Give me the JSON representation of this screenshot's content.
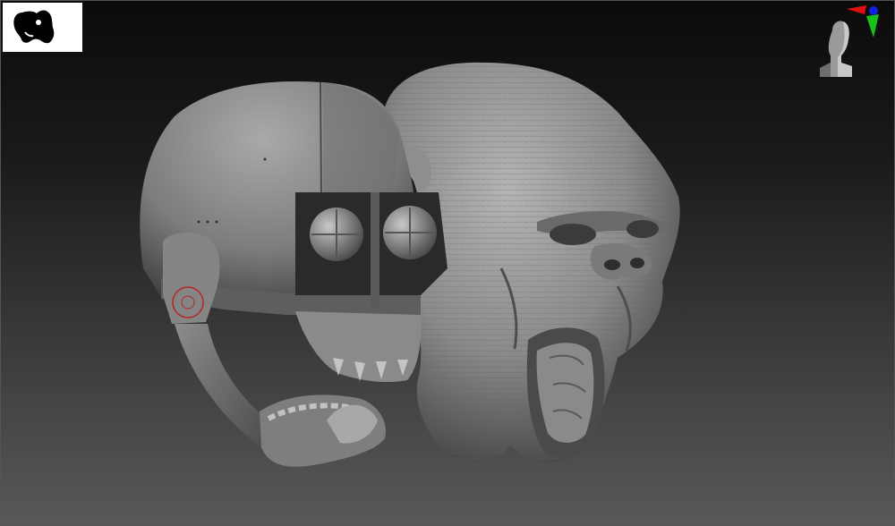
{
  "app": {
    "name": "",
    "view": "3d-viewport"
  },
  "viewport": {
    "background_top": "#0b0b0b",
    "background_bottom": "#595959",
    "thumbnail_icon": "head-silhouette-icon",
    "navigation_icon": "head-nav-cube-icon",
    "axis_colors": {
      "x": "#e01010",
      "y": "#16c016",
      "z": "#1020e0"
    }
  },
  "scene": {
    "objects": [
      "helmet-mesh",
      "gorilla-head-mesh"
    ],
    "marker_color": "#b52424"
  }
}
